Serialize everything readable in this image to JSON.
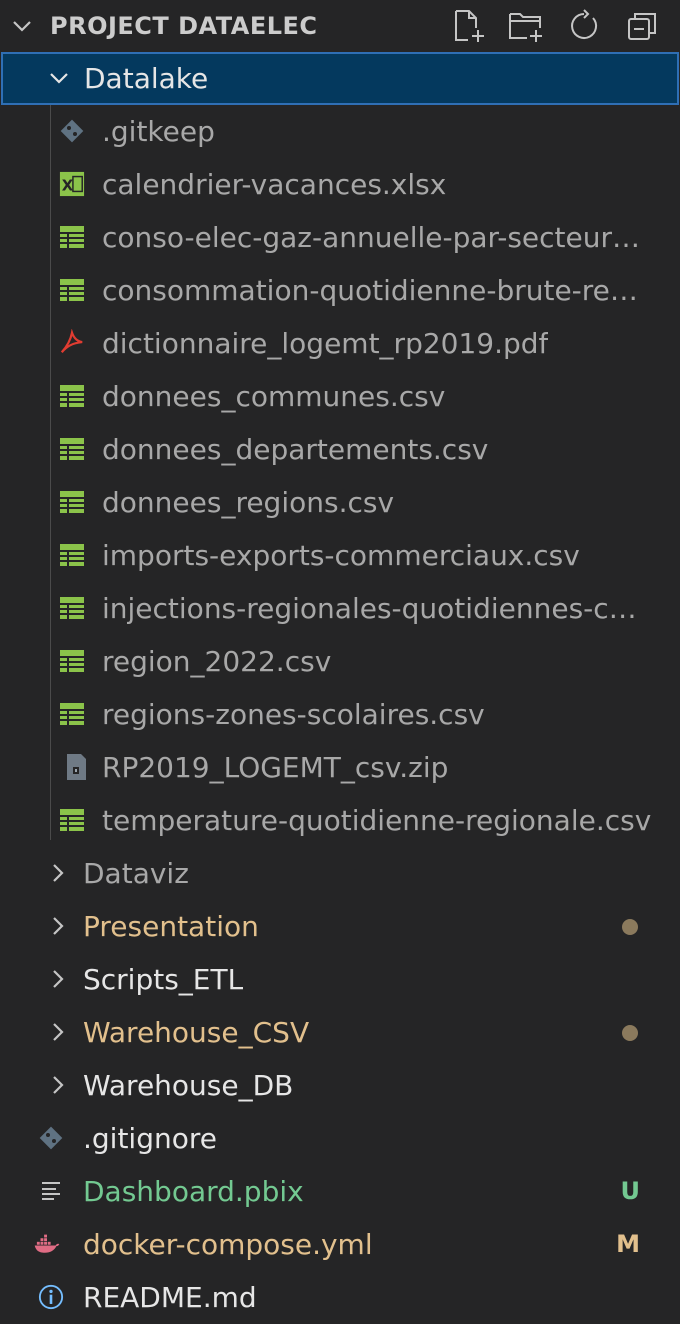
{
  "explorer": {
    "title": "PROJECT DATAELEC",
    "actions": [
      "new-file-icon",
      "new-folder-icon",
      "refresh-icon",
      "collapse-all-icon"
    ]
  },
  "datalake": {
    "label": "Datalake",
    "files": [
      {
        "name": ".gitkeep",
        "icon": "git-icon"
      },
      {
        "name": "calendrier-vacances.xlsx",
        "icon": "excel-icon"
      },
      {
        "name": "conso-elec-gaz-annuelle-par-secteur…",
        "icon": "csv-icon"
      },
      {
        "name": "consommation-quotidienne-brute-re…",
        "icon": "csv-icon"
      },
      {
        "name": "dictionnaire_logemt_rp2019.pdf",
        "icon": "pdf-icon"
      },
      {
        "name": "donnees_communes.csv",
        "icon": "csv-icon"
      },
      {
        "name": "donnees_departements.csv",
        "icon": "csv-icon"
      },
      {
        "name": "donnees_regions.csv",
        "icon": "csv-icon"
      },
      {
        "name": "imports-exports-commerciaux.csv",
        "icon": "csv-icon"
      },
      {
        "name": "injections-regionales-quotidiennes-c…",
        "icon": "csv-icon"
      },
      {
        "name": "region_2022.csv",
        "icon": "csv-icon"
      },
      {
        "name": "regions-zones-scolaires.csv",
        "icon": "csv-icon"
      },
      {
        "name": "RP2019_LOGEMT_csv.zip",
        "icon": "zip-icon"
      },
      {
        "name": "temperature-quotidienne-regionale.csv",
        "icon": "csv-icon"
      }
    ]
  },
  "folders": [
    {
      "name": "Dataviz",
      "status": "normal"
    },
    {
      "name": "Presentation",
      "status": "modified"
    },
    {
      "name": "Scripts_ETL",
      "status": "normal"
    },
    {
      "name": "Warehouse_CSV",
      "status": "modified"
    },
    {
      "name": "Warehouse_DB",
      "status": "normal"
    }
  ],
  "root_files": [
    {
      "name": ".gitignore",
      "icon": "git-icon",
      "badge": ""
    },
    {
      "name": "Dashboard.pbix",
      "icon": "text-lines-icon",
      "badge": "U"
    },
    {
      "name": "docker-compose.yml",
      "icon": "docker-icon",
      "badge": "M"
    },
    {
      "name": "README.md",
      "icon": "info-icon",
      "badge": ""
    }
  ],
  "colors": {
    "background": "#252526",
    "selection": "#04395e",
    "modified": "#e2c08d",
    "untracked": "#73c991",
    "csv_green": "#8bc34a",
    "pdf_red": "#e03c31",
    "docker": "#e06c84",
    "info_blue": "#75beff"
  }
}
